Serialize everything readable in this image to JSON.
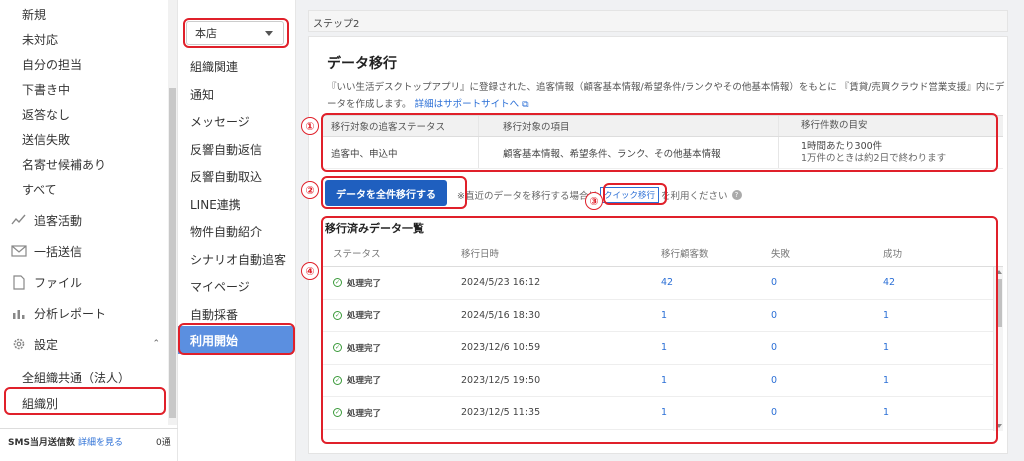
{
  "sidebar": {
    "items": [
      "新規",
      "未対応",
      "自分の担当",
      "下書き中",
      "返答なし",
      "送信失敗",
      "名寄せ候補あり",
      "すべて"
    ],
    "nav": [
      {
        "label": "追客活動",
        "icon": "activity-icon"
      },
      {
        "label": "一括送信",
        "icon": "mail-icon"
      },
      {
        "label": "ファイル",
        "icon": "file-icon"
      },
      {
        "label": "分析レポート",
        "icon": "chart-icon"
      },
      {
        "label": "設定",
        "icon": "gear-icon"
      }
    ],
    "settings_items": [
      "全組織共通（法人）",
      "組織別"
    ],
    "sms_label": "SMS当月送信数",
    "sms_link": "詳細を見る",
    "sms_count": "0通"
  },
  "submenu": {
    "store_select": "本店",
    "items": [
      "組織関連",
      "通知",
      "メッセージ",
      "反響自動返信",
      "反響自動取込",
      "LINE連携",
      "物件自動紹介",
      "シナリオ自動追客",
      "マイページ",
      "自動採番"
    ],
    "active": "利用開始"
  },
  "main": {
    "step_label": "ステップ2",
    "title": "データ移行",
    "description": "『いい生活デスクトップアプリ』に登録された、追客情報（顧客基本情報/希望条件/ランクやその他基本情報）をもとに 『賃貸/売買クラウド営業支援』内にデータを作成します。",
    "description_link": "詳細はサポートサイトへ",
    "migration_table": {
      "headers": [
        "移行対象の追客ステータス",
        "移行対象の項目",
        "移行件数の目安"
      ],
      "row": {
        "status": "追客中、申込中",
        "items": "顧客基本情報、希望条件、ランク、その他基本情報",
        "estimate_line1": "1時間あたり300件",
        "estimate_line2": "1万件のときは約2日で終わります"
      }
    },
    "migrate_button": "データを全件移行する",
    "note_prefix": "※直近のデータを移行する場合は",
    "quick_link": "クイック移行",
    "note_suffix": "を利用ください",
    "list_title": "移行済みデータ一覧",
    "list_headers": [
      "ステータス",
      "移行日時",
      "移行顧客数",
      "失敗",
      "成功"
    ],
    "rows": [
      {
        "status": "処理完了",
        "date": "2024/5/23 16:12",
        "count": "42",
        "fail": "0",
        "ok": "42"
      },
      {
        "status": "処理完了",
        "date": "2024/5/16 18:30",
        "count": "1",
        "fail": "0",
        "ok": "1"
      },
      {
        "status": "処理完了",
        "date": "2023/12/6 10:59",
        "count": "1",
        "fail": "0",
        "ok": "1"
      },
      {
        "status": "処理完了",
        "date": "2023/12/5 19:50",
        "count": "1",
        "fail": "0",
        "ok": "1"
      },
      {
        "status": "処理完了",
        "date": "2023/12/5 11:35",
        "count": "1",
        "fail": "0",
        "ok": "1"
      }
    ]
  },
  "annotations": [
    "①",
    "②",
    "③",
    "④"
  ],
  "colors": {
    "accent": "#1f5fbf",
    "active_menu": "#5b8fe0",
    "annotation": "#e0202a",
    "link": "#2b6fd6"
  }
}
